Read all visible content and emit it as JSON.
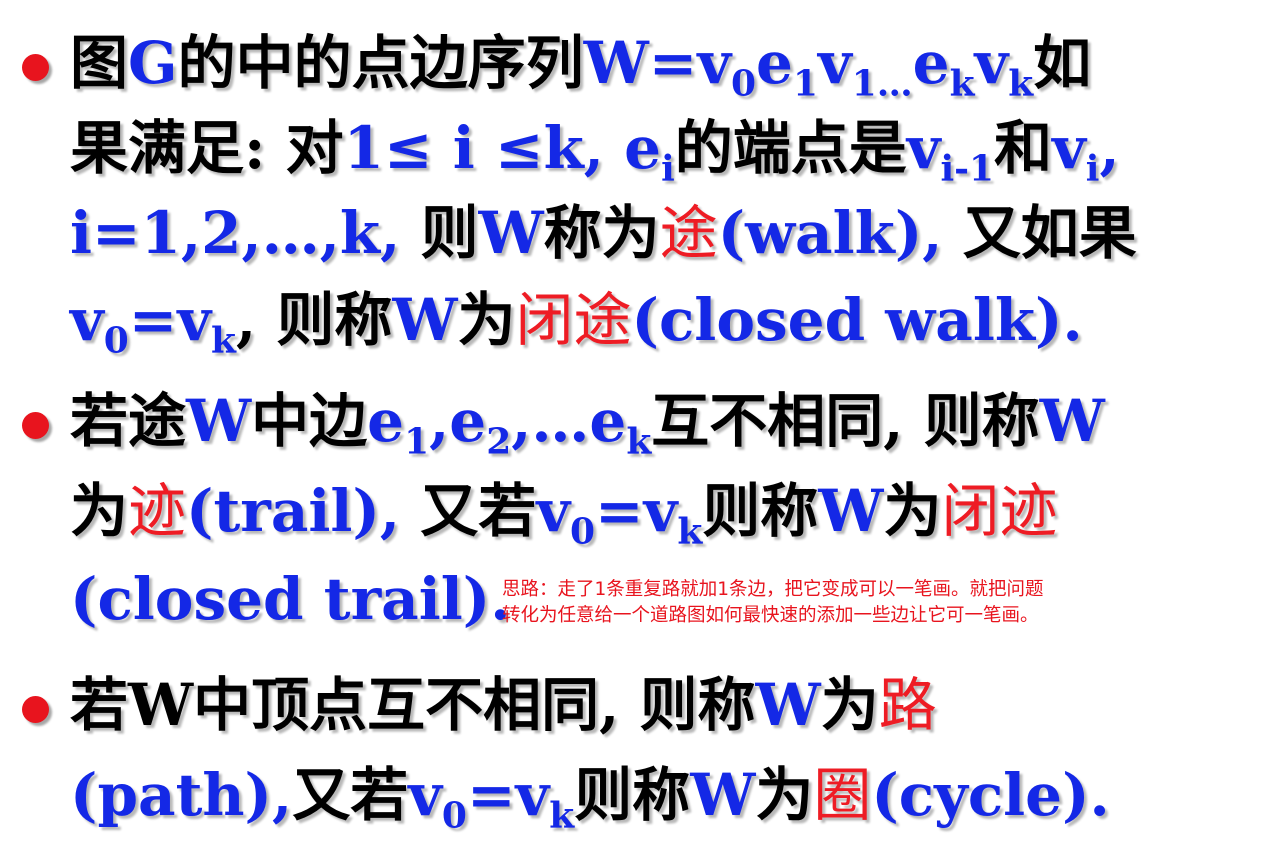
{
  "colors": {
    "blue": "#1428e6",
    "red": "#ee1c24",
    "black": "#000000",
    "bullet": "#e8141e"
  },
  "b1": {
    "l1": {
      "t1": "图",
      "t2": "G",
      "t3": "的中的点边序列",
      "t4": "W=v",
      "s1": "0",
      "t5": "e",
      "s2": "1",
      "t6": "v",
      "s3": "1…",
      "t7": "e",
      "s4": "k",
      "t8": "v",
      "s5": "k",
      "t9": "如"
    },
    "l2": {
      "t1": "果满足: 对",
      "t2": "1≤ i ≤k, e",
      "s1": "i",
      "t3": "的端点是",
      "t4": "v",
      "s2": "i-1",
      "t5": "和",
      "t6": "v",
      "s3": "i",
      "t7": ","
    },
    "l3": {
      "t1": "i=1,2,…,k,",
      "t2": " 则",
      "t3": "W",
      "t4": "称为",
      "t5": "途",
      "t6": "(walk),",
      "t7": " 又如果"
    },
    "l4": {
      "t1": "v",
      "s1": "0",
      "t2": "=v",
      "s2": "k",
      "t3": ", 则称",
      "t4": "W",
      "t5": "为",
      "t6": "闭途",
      "t7": "(closed walk)."
    }
  },
  "b2": {
    "l1": {
      "t1": "若途",
      "t2": "W",
      "t3": "中边",
      "t4": "e",
      "s1": "1",
      "t5": ",e",
      "s2": "2",
      "t6": ",…e",
      "s3": "k",
      "t7": "互不相同, 则称",
      "t8": "W"
    },
    "l2": {
      "t1": "为",
      "t2": "迹",
      "t3": "(trail),",
      "t4": " 又若",
      "t5": "v",
      "s1": "0",
      "t6": "=v",
      "s2": "k",
      "t7": "则称",
      "t8": "W",
      "t9": "为",
      "t10": "闭迹"
    },
    "l3": {
      "t1": "(closed trail)."
    }
  },
  "b3": {
    "l1": {
      "t1": "若",
      "t2": "W",
      "t3": "中顶点互不相同, 则称",
      "t4": "W",
      "t5": "为",
      "t6": "路"
    },
    "l2": {
      "t1": "(path),",
      "t2": "又若",
      "t3": "v",
      "s1": "0",
      "t4": "=v",
      "s2": "k",
      "t5": "则称",
      "t6": "W",
      "t7": "为",
      "t8": "圈",
      "t9": "(cycle)."
    }
  },
  "note": {
    "line1": "思路：走了1条重复路就加1条边，把它变成可以一笔画。就把问题",
    "line2": "转化为任意给一个道路图如何最快速的添加一些边让它可一笔画。"
  }
}
